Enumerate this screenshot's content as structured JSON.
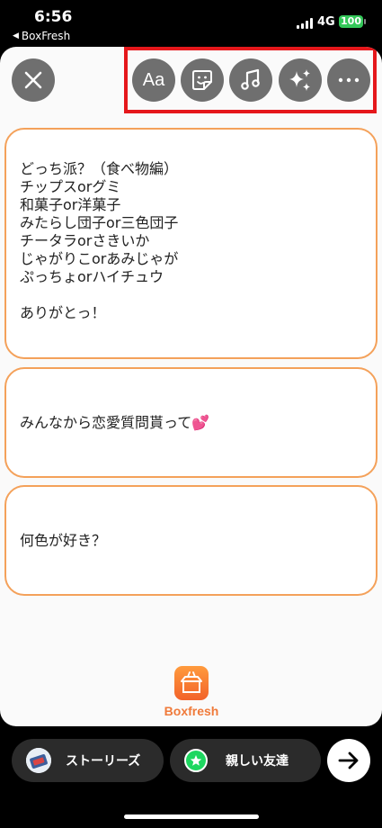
{
  "status_bar": {
    "time": "6:56",
    "back_app": "BoxFresh",
    "network": "4G",
    "battery": "100"
  },
  "toolbar": {
    "text_label": "Aa",
    "buttons": [
      "close-icon",
      "text-icon",
      "sticker-icon",
      "music-icon",
      "effects-icon",
      "more-icon"
    ],
    "highlight_color": "#e5171b"
  },
  "cards": {
    "card1_lines": [
      "どっち派？（食べ物編）",
      "チップスorグミ",
      "和菓子or洋菓子",
      "みたらし団子or三色団子",
      "チータラorさきいか",
      "じゃがりこorあみじゃが",
      "ぷっちょorハイチュウ",
      "",
      "ありがとっ！"
    ],
    "card2_text": "みんなから恋愛質問貰って",
    "card2_emoji": "💕",
    "card3_text": "何色が好き？",
    "border_color": "#f4a15a"
  },
  "brand": {
    "name": "Boxfresh"
  },
  "share": {
    "stories_label": "ストーリーズ",
    "close_friends_label": "親しい友達",
    "next_icon": "arrow-right-icon"
  }
}
